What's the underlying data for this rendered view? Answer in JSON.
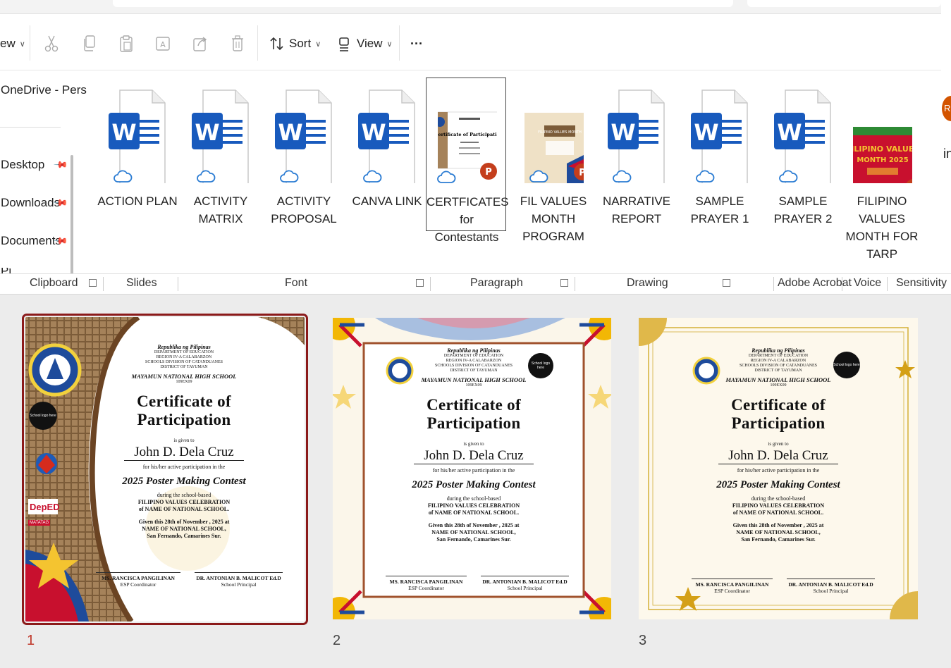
{
  "toolbar": {
    "new_partial": "ew",
    "sort_label": "Sort",
    "view_label": "View",
    "more_label": "···"
  },
  "nav": {
    "onedrive": "OneDrive - Pers",
    "desktop": "Desktop",
    "downloads": "Downloads",
    "documents": "Documents",
    "pictures_partial": "Pi"
  },
  "files": [
    {
      "name": "ACTION PLAN",
      "type": "word"
    },
    {
      "name": "ACTIVITY MATRIX",
      "type": "word"
    },
    {
      "name": "ACTIVITY PROPOSAL",
      "type": "word"
    },
    {
      "name": "CANVA LINK",
      "type": "word"
    },
    {
      "name": "CERTFICATES for Contestants",
      "type": "pptx-thumb",
      "selected": true
    },
    {
      "name": "FIL VALUES MONTH PROGRAM",
      "type": "pptx-thumb"
    },
    {
      "name": "NARRATIVE REPORT",
      "type": "word"
    },
    {
      "name": "SAMPLE PRAYER 1",
      "type": "word"
    },
    {
      "name": "SAMPLE PRAYER 2",
      "type": "word"
    },
    {
      "name": "FILIPINO VALUES MONTH FOR TARP",
      "type": "pptx-thumb"
    }
  ],
  "thumb_texts": {
    "tarp_line1": "FILIPINO VALUES",
    "tarp_line2": "MONTH 2025",
    "fil_values_header": "FILIPINO VALUES MONTH",
    "cert_thumb_title": "Certificate of Participation",
    "word_letter": "W",
    "ppt_letter": "P"
  },
  "ribbon_groups": {
    "clipboard": "Clipboard",
    "slides": "Slides",
    "font": "Font",
    "paragraph": "Paragraph",
    "drawing": "Drawing",
    "adobe": "Adobe Acrobat",
    "voice": "Voice",
    "sensitivity": "Sensitivity"
  },
  "right_peek": {
    "avatar_letter": "R",
    "text": "in"
  },
  "certificate": {
    "republic": "Republika ng Pilipinas",
    "deped": "DEPARTMENT OF EDUCATION",
    "region": "REGION IV-A CALABARZON",
    "division": "SCHOOLS DIVISION OF CATANDUANES",
    "district": "DISTRICT OF TAYUMAN",
    "school": "MAYAMUN NATIONAL HIGH SCHOOL",
    "school_id": "109EX09",
    "title": "Certificate of Participation",
    "given_to": "is given to",
    "name": "John D. Dela Cruz",
    "participation": "for his/her active participation in the",
    "contest": "2025 Poster Making Contest",
    "during": "during the school-based",
    "celebration": "FILIPINO VALUES CELEBRATION",
    "of_school": "of NAME OF NATIONAL SCHOOL.",
    "given_this": "Given this 28th of November , 2025 at",
    "given_place": "NAME OF NATIONAL SCHOOL,",
    "location": "San Fernando, Camarines Sur.",
    "sig1_name": "MS. RANCISCA PANGILINAN",
    "sig1_role": "ESP Coordinator",
    "sig2_name": "DR. ANTONIAN B. MALICOT Ed.D",
    "sig2_role": "School Principal",
    "logo_text": "School logo here",
    "deped_logo": "DepED",
    "matatag": "MATATAG",
    "seal_text": "KAGAWARAN NG EDUKASYON"
  },
  "slides": [
    {
      "number": "1",
      "active": true
    },
    {
      "number": "2",
      "active": false
    },
    {
      "number": "3",
      "active": false
    }
  ],
  "colors": {
    "word_blue": "#185abd",
    "ppt_red": "#c43e1c",
    "slide_border": "#8b1a1a",
    "cloud_blue": "#2b7cd3"
  }
}
